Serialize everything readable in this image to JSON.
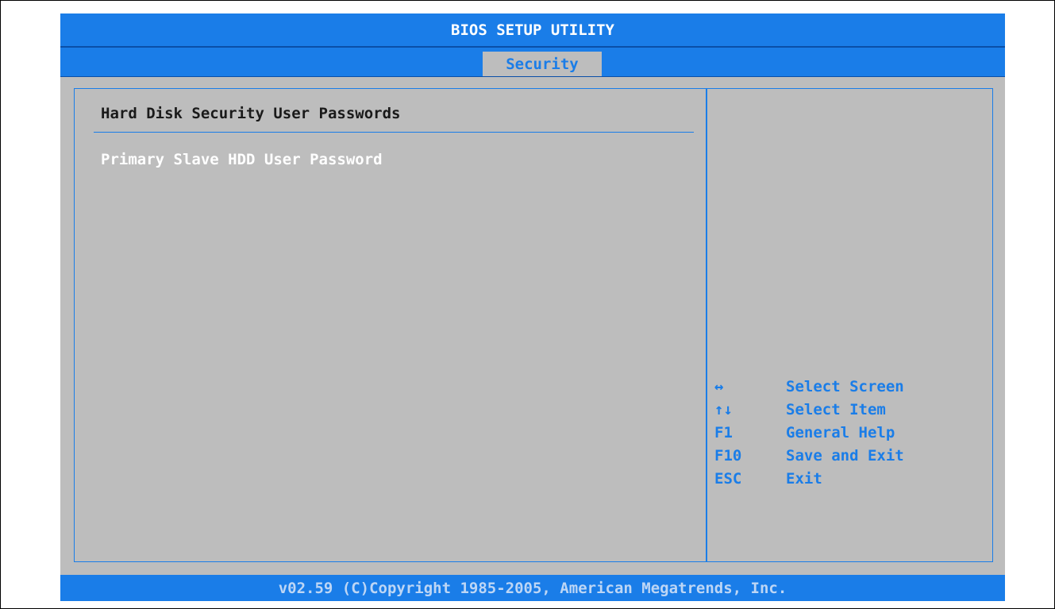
{
  "window": {
    "title": "BIOS SETUP UTILITY"
  },
  "menu": {
    "active_tab": "Security"
  },
  "main": {
    "section_title": "Hard Disk Security User Passwords",
    "items": [
      {
        "label": "Primary Slave HDD User Password"
      }
    ]
  },
  "help": {
    "keys": [
      {
        "key": "↔",
        "desc": "Select Screen",
        "icon": "left-right-arrow-icon"
      },
      {
        "key": "↑↓",
        "desc": "Select Item",
        "icon": "up-down-arrow-icon"
      },
      {
        "key": "F1",
        "desc": "General Help"
      },
      {
        "key": "F10",
        "desc": "Save and Exit"
      },
      {
        "key": "ESC",
        "desc": "Exit"
      }
    ]
  },
  "footer": {
    "text": "v02.59 (C)Copyright 1985-2005, American Megatrends, Inc."
  },
  "colors": {
    "accent": "#1a7de8",
    "background": "#bdbdbd",
    "highlight_text": "#ffffff"
  }
}
